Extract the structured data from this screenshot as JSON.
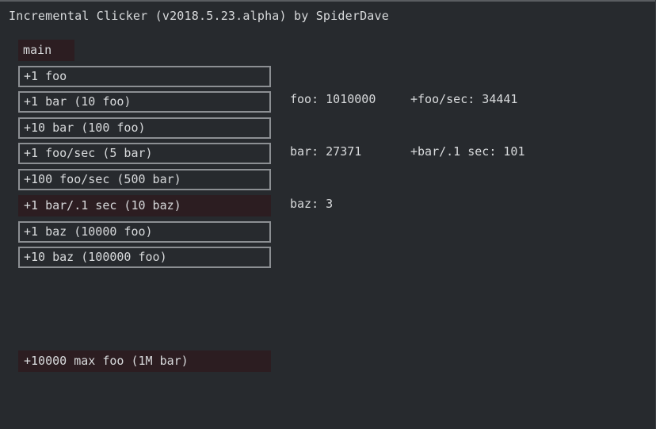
{
  "app": {
    "title": "Incremental Clicker (v2018.5.23.alpha) by SpiderDave"
  },
  "tabs": {
    "main_label": "main"
  },
  "buttons": {
    "add_1_foo": "+1 foo",
    "add_1_bar": "+1 bar (10 foo)",
    "add_10_bar": "+10 bar (100 foo)",
    "add_1_foo_per_sec": "+1 foo/sec (5 bar)",
    "add_100_foo_per_sec": "+100 foo/sec (500 bar)",
    "add_1_bar_per_tenth_sec": "+1 bar/.1 sec (10 baz)",
    "add_1_baz": "+1 baz (10000 foo)",
    "add_10_baz": "+10 baz (100000 foo)",
    "add_10000_max_foo": "+10000 max foo (1M bar)"
  },
  "stats": {
    "foo": "foo: 1010000",
    "bar": "bar: 27371",
    "baz": "baz: 3",
    "foo_per_sec": "+foo/sec: 34441",
    "bar_per_tenth_sec": "+bar/.1 sec: 101"
  },
  "colors": {
    "background": "#272a2e",
    "text": "#d8dadc",
    "button_border": "#8c8f93",
    "disabled_fill": "#2c1d21"
  }
}
